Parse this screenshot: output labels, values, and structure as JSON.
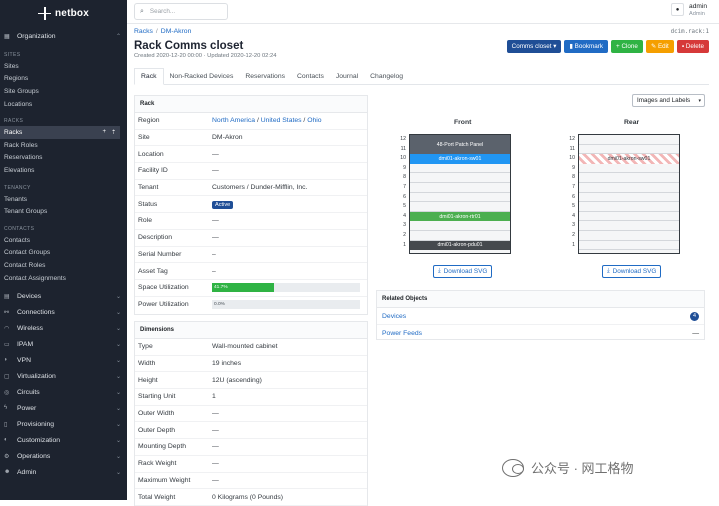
{
  "app": {
    "name": "netbox"
  },
  "search": {
    "placeholder": "Search..."
  },
  "user": {
    "name": "admin",
    "role": "Admin"
  },
  "sidebar": {
    "organization": "Organization",
    "sections": [
      {
        "title": "SITES",
        "items": [
          "Sites",
          "Regions",
          "Site Groups",
          "Locations"
        ]
      },
      {
        "title": "RACKS",
        "items": [
          "Racks",
          "Rack Roles",
          "Reservations",
          "Elevations"
        ]
      },
      {
        "title": "TENANCY",
        "items": [
          "Tenants",
          "Tenant Groups"
        ]
      },
      {
        "title": "CONTACTS",
        "items": [
          "Contacts",
          "Contact Groups",
          "Contact Roles",
          "Contact Assignments"
        ]
      }
    ],
    "rack_actions": {
      "add": "+",
      "import": "⇡"
    },
    "groups": [
      "Devices",
      "Connections",
      "Wireless",
      "IPAM",
      "VPN",
      "Virtualization",
      "Circuits",
      "Power",
      "Provisioning",
      "Customization",
      "Operations",
      "Admin"
    ]
  },
  "breadcrumb": [
    "Racks",
    "DM-Akron"
  ],
  "page": {
    "title": "Rack Comms closet",
    "meta": "Created 2020-12-20 00:00 · Updated 2020-12-20 02:24",
    "object_id": "dcim.rack:1"
  },
  "buttons": {
    "rack": "Comms closet",
    "bookmark": "Bookmark",
    "clone": "Clone",
    "edit": "Edit",
    "delete": "Delete"
  },
  "tabs": [
    "Rack",
    "Non-Racked Devices",
    "Reservations",
    "Contacts",
    "Journal",
    "Changelog"
  ],
  "rack_card": {
    "title": "Rack",
    "region": [
      "North America",
      "United States",
      "Ohio"
    ],
    "rows": [
      {
        "k": "Site",
        "v": "DM-Akron",
        "link": true
      },
      {
        "k": "Location",
        "v": "—"
      },
      {
        "k": "Facility ID",
        "v": "—"
      },
      {
        "k": "Tenant",
        "v": "Customers / Dunder-Mifflin, Inc.",
        "link": true
      },
      {
        "k": "Status",
        "v": "Active",
        "badge": true
      },
      {
        "k": "Role",
        "v": "—"
      },
      {
        "k": "Description",
        "v": "—"
      },
      {
        "k": "Serial Number",
        "v": "–"
      },
      {
        "k": "Asset Tag",
        "v": "–"
      }
    ],
    "region_label": "Region",
    "space_label": "Space Utilization",
    "space_value": 41.7,
    "space_text": "41.7%",
    "power_label": "Power Utilization",
    "power_value": 0.0,
    "power_text": "0.0%"
  },
  "dimensions": {
    "title": "Dimensions",
    "rows": [
      {
        "k": "Type",
        "v": "Wall-mounted cabinet"
      },
      {
        "k": "Width",
        "v": "19 inches"
      },
      {
        "k": "Height",
        "v": "12U (ascending)"
      },
      {
        "k": "Starting Unit",
        "v": "1"
      },
      {
        "k": "Outer Width",
        "v": "—"
      },
      {
        "k": "Outer Depth",
        "v": "—"
      },
      {
        "k": "Mounting Depth",
        "v": "—"
      },
      {
        "k": "Rack Weight",
        "v": "—"
      },
      {
        "k": "Maximum Weight",
        "v": "—"
      },
      {
        "k": "Total Weight",
        "v": "0 Kilograms (0 Pounds)"
      }
    ]
  },
  "elevation": {
    "select": "Images and Labels",
    "front_label": "Front",
    "rear_label": "Rear",
    "units": [
      12,
      11,
      10,
      9,
      8,
      7,
      6,
      5,
      4,
      3,
      2,
      1
    ],
    "front_devices": [
      {
        "name": "48-Port Patch Panel",
        "top_u": 12,
        "height_u": 2,
        "color": "#5b626c"
      },
      {
        "name": "dmi01-akron-sw01",
        "top_u": 10,
        "height_u": 1,
        "color": "#2196f3"
      },
      {
        "name": "dmi01-akron-rtr01",
        "top_u": 4,
        "height_u": 1,
        "color": "#4caf50"
      },
      {
        "name": "dmi01-akron-pdu01",
        "top_u": 1,
        "height_u": 1,
        "color": "#45494e"
      }
    ],
    "rear_devices": [
      {
        "name": "dmi01-akron-sw01",
        "top_u": 10,
        "height_u": 1,
        "striped": true
      }
    ],
    "download": "Download SVG"
  },
  "related": {
    "title": "Related Objects",
    "rows": [
      {
        "label": "Devices",
        "count": "4"
      },
      {
        "label": "Power Feeds",
        "count": "—"
      }
    ]
  },
  "watermark": "公众号 · 网工格物"
}
